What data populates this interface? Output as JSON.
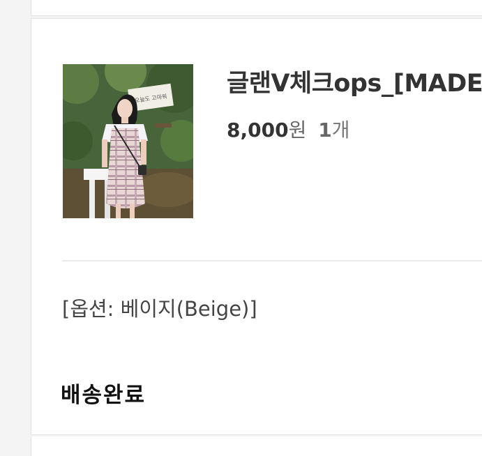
{
  "order_item": {
    "product_name": "글랜V체크ops_[MADE",
    "price_amount": "8,000",
    "price_unit": "원",
    "quantity": "1",
    "quantity_unit": "개",
    "option_text": "[옵션: 베이지(Beige)]",
    "status": "배송완료",
    "thumbnail_icon": "product-photo",
    "banner_text": "오늘도 고마워"
  }
}
